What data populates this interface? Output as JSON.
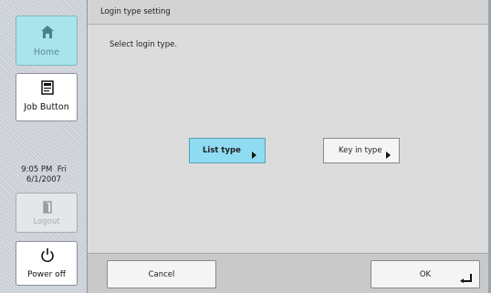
{
  "sidebar": {
    "home_label": "Home",
    "job_button_label": "Job Button",
    "clock_time": "9:05 PM  Fri",
    "clock_date": "6/1/2007",
    "logout_label": "Logout",
    "power_label": "Power off",
    "icons": {
      "home": "home-icon",
      "job": "job-button-icon",
      "logout": "logout-door-icon",
      "power": "power-icon"
    }
  },
  "screen": {
    "title": "Login type setting",
    "prompt": "Select login type."
  },
  "options": {
    "list_type_label": "List type",
    "key_in_type_label": "Key in type",
    "selected": "List type"
  },
  "actions": {
    "cancel_label": "Cancel",
    "ok_label": "OK"
  },
  "colors": {
    "selected_option": "#8fdcf2",
    "home_button": "#a9e3ec",
    "panel_bg": "#dcdcdc"
  }
}
